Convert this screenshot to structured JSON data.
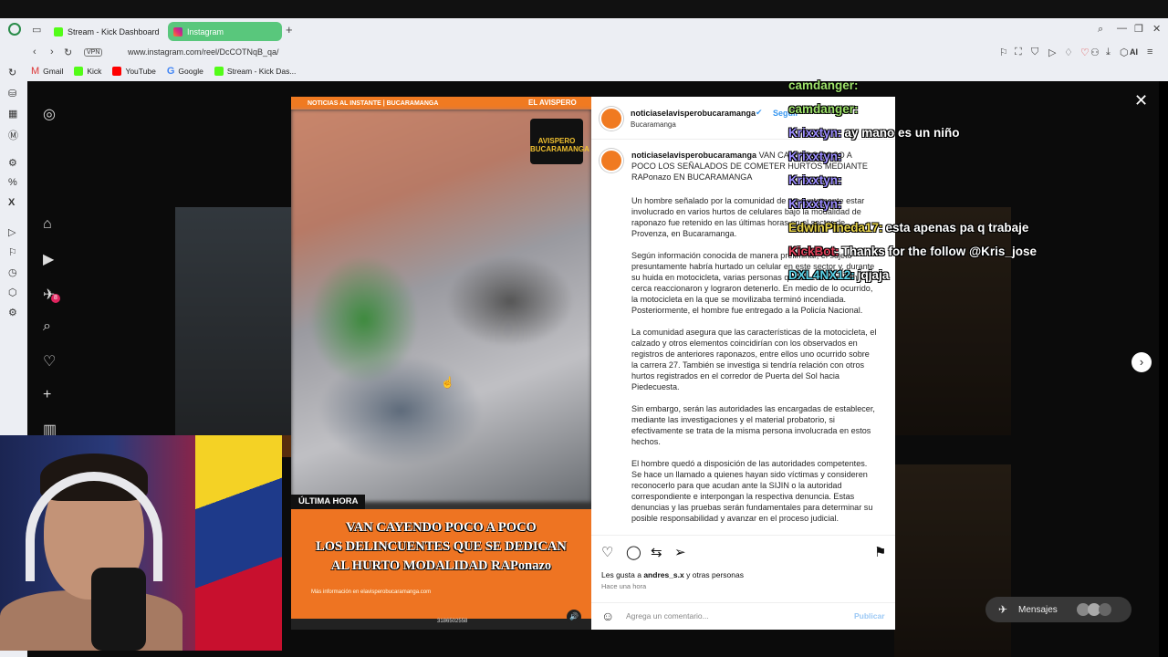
{
  "browser": {
    "tabs": [
      {
        "label": "Stream - Kick Dashboard"
      },
      {
        "label": "Instagram"
      }
    ],
    "url": "www.instagram.com/reel/DcCOTNqB_qa/",
    "vpn": "VPN",
    "ai": "AI",
    "bookmarks": [
      "Gmail",
      "Kick",
      "YouTube",
      "Google",
      "Stream - Kick Das..."
    ],
    "badge_count": "8"
  },
  "video": {
    "top_banner": "NOTICIAS AL INSTANTE  |  BUCARAMANGA",
    "top_right": "EL AVISPERO",
    "logo": "AVISPERO BUCARAMANGA",
    "label": "ÚLTIMA HORA",
    "headline_1": "VAN CAYENDO POCO A POCO",
    "headline_2": "LOS DELINCUENTES QUE SE DEDICAN",
    "headline_3": "AL HURTO MODALIDAD RAPonazo",
    "info": "Más información en elavisperobucaramanga.com",
    "phone": "3186502558"
  },
  "post": {
    "username": "noticiaselavisperobucaramanga",
    "follow": "Seguir",
    "location": "Bucaramanga",
    "caption_title": "VAN CAYENDO POCO A POCO LOS SEÑALADOS DE COMETER HURTOS MEDIANTE RAPonazo EN BUCARAMANGA",
    "paragraphs": [
      "Un hombre señalado por la comunidad de presuntamente estar involucrado en varios hurtos de celulares bajo la modalidad de raponazo fue retenido en las últimas horas en el sector de Provenza, en Bucaramanga.",
      "Según información conocida de manera preliminar, el sujeto presuntamente habría hurtado un celular en este sector y, durante su huida en motocicleta, varias personas que se encontraban cerca reaccionaron y lograron detenerlo. En medio de lo ocurrido, la motocicleta en la que se movilizaba terminó incendiada. Posteriormente, el hombre fue entregado a la Policía Nacional.",
      "La comunidad asegura que las características de la motocicleta, el calzado y otros elementos coincidirían con los observados en registros de anteriores raponazos, entre ellos uno ocurrido sobre la carrera 27. También se investiga si tendría relación con otros hurtos registrados en el corredor de Puerta del Sol hacia Piedecuesta.",
      "Sin embargo, serán las autoridades las encargadas de establecer, mediante las investigaciones y el material probatorio, si efectivamente se trata de la misma persona involucrada en estos hechos.",
      "El hombre quedó a disposición de las autoridades competentes. Se hace un llamado a quienes hayan sido víctimas y consideren reconocerlo para que acudan ante la SIJIN o la autoridad correspondiente e interpongan la respectiva denuncia. Estas denuncias y las pruebas serán fundamentales para determinar su posible responsabilidad y avanzar en el proceso judicial."
    ],
    "likes_prefix": "Les gusta a",
    "likes_user": "andres_s.x",
    "likes_suffix": "y otras personas",
    "time": "Hace una hora",
    "comment_placeholder": "Agrega un comentario...",
    "publish": "Publicar",
    "messages": "Mensajes"
  },
  "chat": [
    {
      "user": "camdanger:",
      "msg": "",
      "color": "#9ee36b"
    },
    {
      "user": "camdanger:",
      "msg": "",
      "color": "#9ee36b"
    },
    {
      "user": "Krixxtyn:",
      "msg": "ay mano es un niño",
      "color": "#9b8cff"
    },
    {
      "user": "Krixxtyn:",
      "msg": "",
      "color": "#9b8cff"
    },
    {
      "user": "Krixxtyn:",
      "msg": "",
      "color": "#9b8cff"
    },
    {
      "user": "Krixxtyn:",
      "msg": "",
      "color": "#9b8cff"
    },
    {
      "user": "EdwinPineda17:",
      "msg": "esta apenas pa q trabaje",
      "color": "#e9d54b"
    },
    {
      "user": "KickBot:",
      "msg": "Thanks for the follow @Kris_jose",
      "color": "#e0405a"
    },
    {
      "user": "DXL4NX12:",
      "msg": "jqjaja",
      "color": "#5ad1e6"
    }
  ]
}
